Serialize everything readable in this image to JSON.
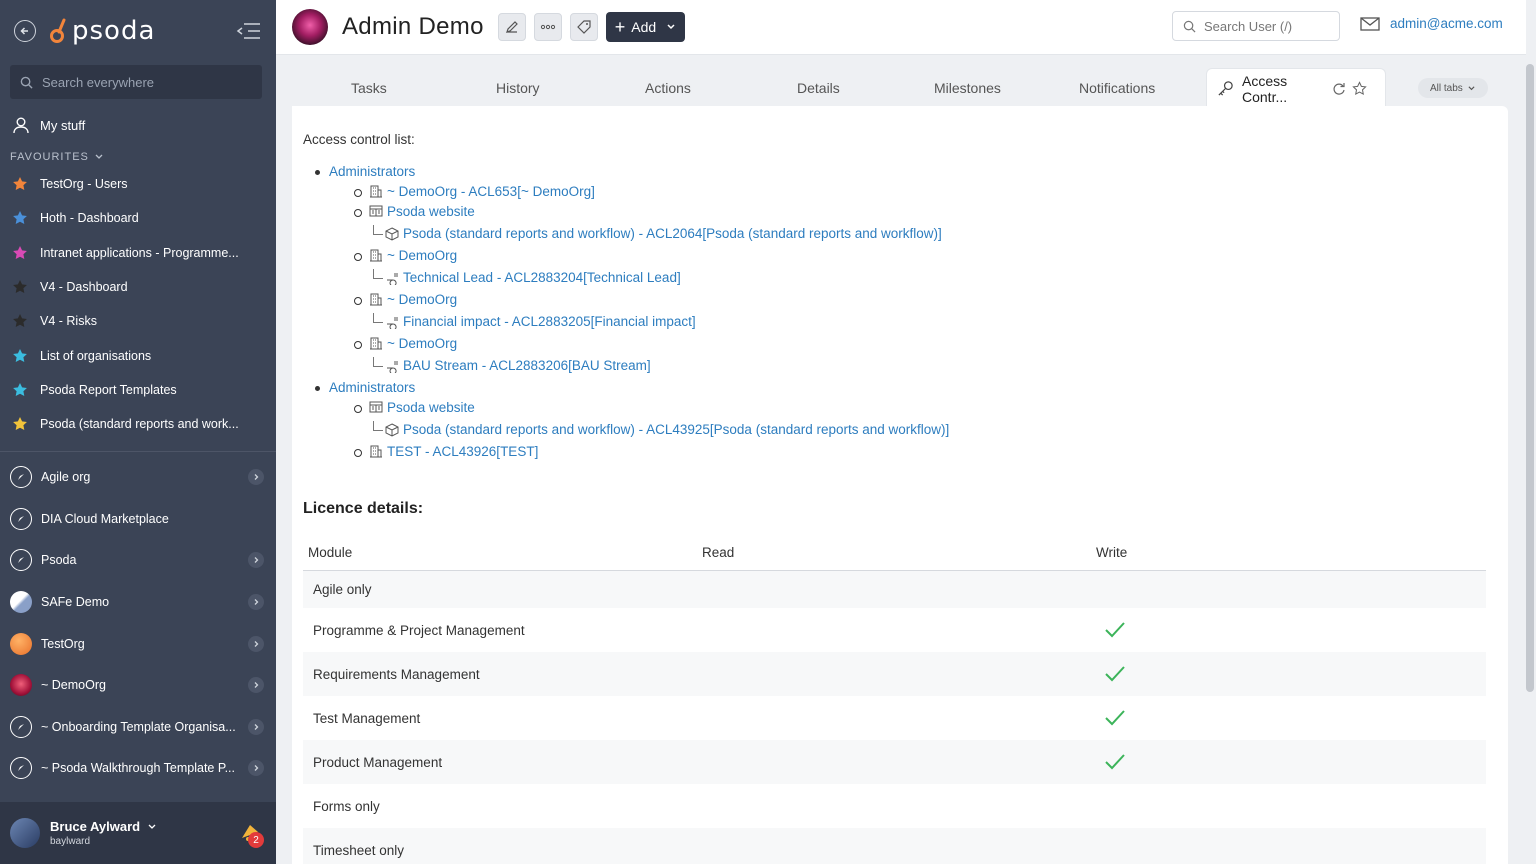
{
  "sidebar": {
    "logo_text": "psoda",
    "search_placeholder": "Search everywhere",
    "my_stuff": "My stuff",
    "favourites_heading": "FAVOURITES",
    "favourites": [
      {
        "label": "TestOrg - Users",
        "color": "#f2853b"
      },
      {
        "label": "Hoth - Dashboard",
        "color": "#4a90d9"
      },
      {
        "label": "Intranet applications - Programme...",
        "color": "#d94ab5"
      },
      {
        "label": "V4 - Dashboard",
        "color": "#2b2b2b"
      },
      {
        "label": "V4 - Risks",
        "color": "#2b2b2b"
      },
      {
        "label": "List of organisations",
        "color": "#3bbde0"
      },
      {
        "label": "Psoda Report Templates",
        "color": "#3bbde0"
      },
      {
        "label": "Psoda (standard reports and work...",
        "color": "#f2c43b"
      }
    ],
    "orgs": [
      {
        "label": "Agile org",
        "icon": "compass-icon",
        "chevron": true
      },
      {
        "label": "DIA Cloud Marketplace",
        "icon": "compass-icon",
        "chevron": false
      },
      {
        "label": "Psoda",
        "icon": "compass-icon",
        "chevron": true
      },
      {
        "label": "SAFe Demo",
        "icon": "safe-logo-icon",
        "chevron": true
      },
      {
        "label": "TestOrg",
        "icon": "orange-sphere-icon",
        "chevron": true
      },
      {
        "label": "~ DemoOrg",
        "icon": "flower-icon",
        "chevron": true
      },
      {
        "label": "~ Onboarding Template Organisa...",
        "icon": "compass-icon",
        "chevron": true
      },
      {
        "label": "~ Psoda Walkthrough Template P...",
        "icon": "compass-icon",
        "chevron": true
      }
    ],
    "user": {
      "name": "Bruce Aylward",
      "username": "baylward",
      "notifications": "2"
    }
  },
  "topbar": {
    "title": "Admin Demo",
    "add_label": "Add",
    "search_placeholder": "Search User (/)",
    "email": "admin@acme.com"
  },
  "tabs": {
    "items": [
      "Tasks",
      "History",
      "Actions",
      "Details",
      "Milestones",
      "Notifications"
    ],
    "active": "Access Contr...",
    "all_tabs": "All tabs"
  },
  "acl": {
    "label": "Access control list:",
    "groups": [
      {
        "name": "Administrators",
        "entries": [
          {
            "icon": "building-icon",
            "text": "~ DemoOrg - ACL653[~ DemoOrg]",
            "child": null
          },
          {
            "icon": "website-icon",
            "text": "Psoda website",
            "child": {
              "icon": "package-icon",
              "text": "Psoda (standard reports and workflow) - ACL2064[Psoda (standard reports and workflow)]"
            }
          },
          {
            "icon": "building-icon",
            "text": "~ DemoOrg",
            "child": {
              "icon": "workstream-icon",
              "text": "Technical Lead - ACL2883204[Technical Lead]"
            }
          },
          {
            "icon": "building-icon",
            "text": "~ DemoOrg",
            "child": {
              "icon": "workstream-icon",
              "text": "Financial impact - ACL2883205[Financial impact]"
            }
          },
          {
            "icon": "building-icon",
            "text": "~ DemoOrg",
            "child": {
              "icon": "workstream-icon",
              "text": "BAU Stream - ACL2883206[BAU Stream]"
            }
          }
        ]
      },
      {
        "name": "Administrators",
        "entries": [
          {
            "icon": "website-icon",
            "text": "Psoda website",
            "child": {
              "icon": "package-icon",
              "text": "Psoda (standard reports and workflow) - ACL43925[Psoda (standard reports and workflow)]"
            }
          },
          {
            "icon": "building-icon",
            "text": "TEST - ACL43926[TEST]",
            "child": null
          }
        ]
      }
    ]
  },
  "licence": {
    "title": "Licence details:",
    "columns": [
      "Module",
      "Read",
      "Write"
    ],
    "rows": [
      {
        "module": "Agile only",
        "read": false,
        "write": false
      },
      {
        "module": "Programme & Project Management",
        "read": false,
        "write": true
      },
      {
        "module": "Requirements Management",
        "read": false,
        "write": true
      },
      {
        "module": "Test Management",
        "read": false,
        "write": true
      },
      {
        "module": "Product Management",
        "read": false,
        "write": true
      },
      {
        "module": "Forms only",
        "read": false,
        "write": false
      },
      {
        "module": "Timesheet only",
        "read": false,
        "write": false
      }
    ],
    "check_color": "#3cb45a"
  }
}
